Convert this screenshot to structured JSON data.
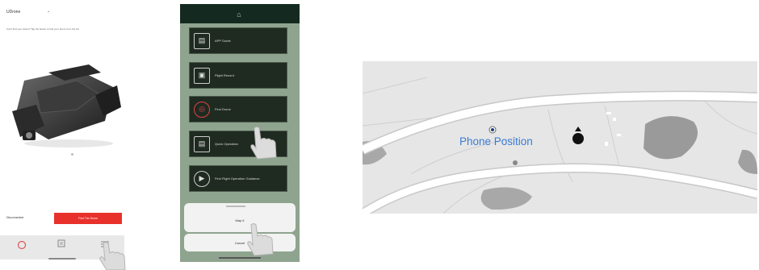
{
  "panel_app_home": {
    "model_label": "UDrone",
    "model_caret": "⌄",
    "notice": "Can't find your drone? Tap the button to find your drone from the list",
    "status_label": "Disconnected",
    "find_button_label": "Find The Drone"
  },
  "panel_menu": {
    "items": [
      {
        "label": "APP Guide",
        "icon": "document-icon"
      },
      {
        "label": "Flight Record",
        "icon": "flight-record-icon"
      },
      {
        "label": "Find Drone",
        "icon": "search-location-icon"
      },
      {
        "label": "Quick Operation",
        "icon": "document-icon"
      },
      {
        "label": "First Flight Operation Guidance",
        "icon": "play-icon"
      }
    ],
    "sheet_top_label": "Map it",
    "cancel_label": "Cancel"
  },
  "panel_map": {
    "phone_position_label": "Phone Position",
    "colors": {
      "map_bg": "#e6e6e6",
      "road": "#ffffff",
      "road_edge": "#c8c8c8",
      "park": "#9a9a9a",
      "marker": "#111111",
      "label": "#3a7bd5"
    }
  }
}
